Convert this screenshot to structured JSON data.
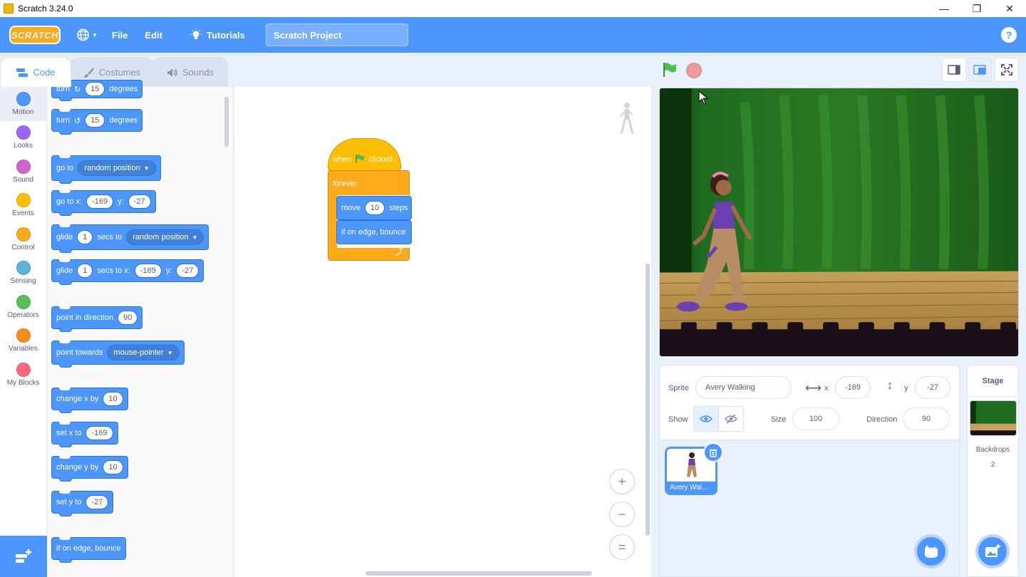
{
  "window": {
    "title": "Scratch 3.24.0",
    "minimize": "—",
    "maximize": "❐",
    "close": "✕"
  },
  "menubar": {
    "logo": "SCRATCH",
    "file": "File",
    "edit": "Edit",
    "tutorials": "Tutorials",
    "project_title": "Scratch Project",
    "help": "?"
  },
  "tabs": [
    {
      "label": "Code"
    },
    {
      "label": "Costumes"
    },
    {
      "label": "Sounds"
    }
  ],
  "categories": [
    {
      "label": "Motion",
      "color": "#4c97ff"
    },
    {
      "label": "Looks",
      "color": "#9966ff"
    },
    {
      "label": "Sound",
      "color": "#cf63cf"
    },
    {
      "label": "Events",
      "color": "#ffbf00"
    },
    {
      "label": "Control",
      "color": "#ffab19"
    },
    {
      "label": "Sensing",
      "color": "#5cb1d6"
    },
    {
      "label": "Operators",
      "color": "#59c059"
    },
    {
      "label": "Variables",
      "color": "#ff8c1a"
    },
    {
      "label": "My Blocks",
      "color": "#ff6680"
    }
  ],
  "palette": {
    "turn_right": {
      "text": "turn",
      "value": "15",
      "unit": "degrees"
    },
    "turn_left": {
      "text": "turn",
      "value": "15",
      "unit": "degrees"
    },
    "goto": {
      "text": "go to",
      "option": "random position"
    },
    "goto_xy": {
      "text": "go to x:",
      "x": "-169",
      "ylabel": "y:",
      "y": "-27"
    },
    "glide_to": {
      "text": "glide",
      "secs": "1",
      "mid": "secs to",
      "option": "random position"
    },
    "glide_xy": {
      "text": "glide",
      "secs": "1",
      "mid": "secs to x:",
      "x": "-169",
      "ylabel": "y:",
      "y": "-27"
    },
    "point_dir": {
      "text": "point in direction",
      "value": "90"
    },
    "point_towards": {
      "text": "point towards",
      "option": "mouse-pointer"
    },
    "change_x": {
      "text": "change x by",
      "value": "10"
    },
    "set_x": {
      "text": "set x to",
      "value": "-169"
    },
    "change_y": {
      "text": "change y by",
      "value": "10"
    },
    "set_y": {
      "text": "set y to",
      "value": "-27"
    },
    "bounce": {
      "text": "if on edge, bounce"
    }
  },
  "script": {
    "hat_when": "when",
    "hat_clicked": "clicked",
    "forever": "forever",
    "move": "move",
    "move_value": "10",
    "move_unit": "steps",
    "bounce": "if on edge, bounce",
    "loop_arrow": "⤴"
  },
  "zoom": {
    "in": "+",
    "out": "−",
    "reset": "="
  },
  "sprite_info": {
    "sprite_label": "Sprite",
    "sprite_name": "Avery Walking",
    "x_label": "x",
    "x": "-169",
    "y_label": "y",
    "y": "-27",
    "show_label": "Show",
    "size_label": "Size",
    "size": "100",
    "direction_label": "Direction",
    "direction": "90"
  },
  "sprite_list": [
    {
      "name": "Avery Wal..."
    }
  ],
  "stage_pane": {
    "header": "Stage",
    "backdrops_label": "Backdrops",
    "backdrops_count": "2"
  },
  "colors": {
    "accent": "#4c97ff",
    "motion": "#4c97ff",
    "events": "#ffbf00",
    "control": "#ffab19"
  }
}
